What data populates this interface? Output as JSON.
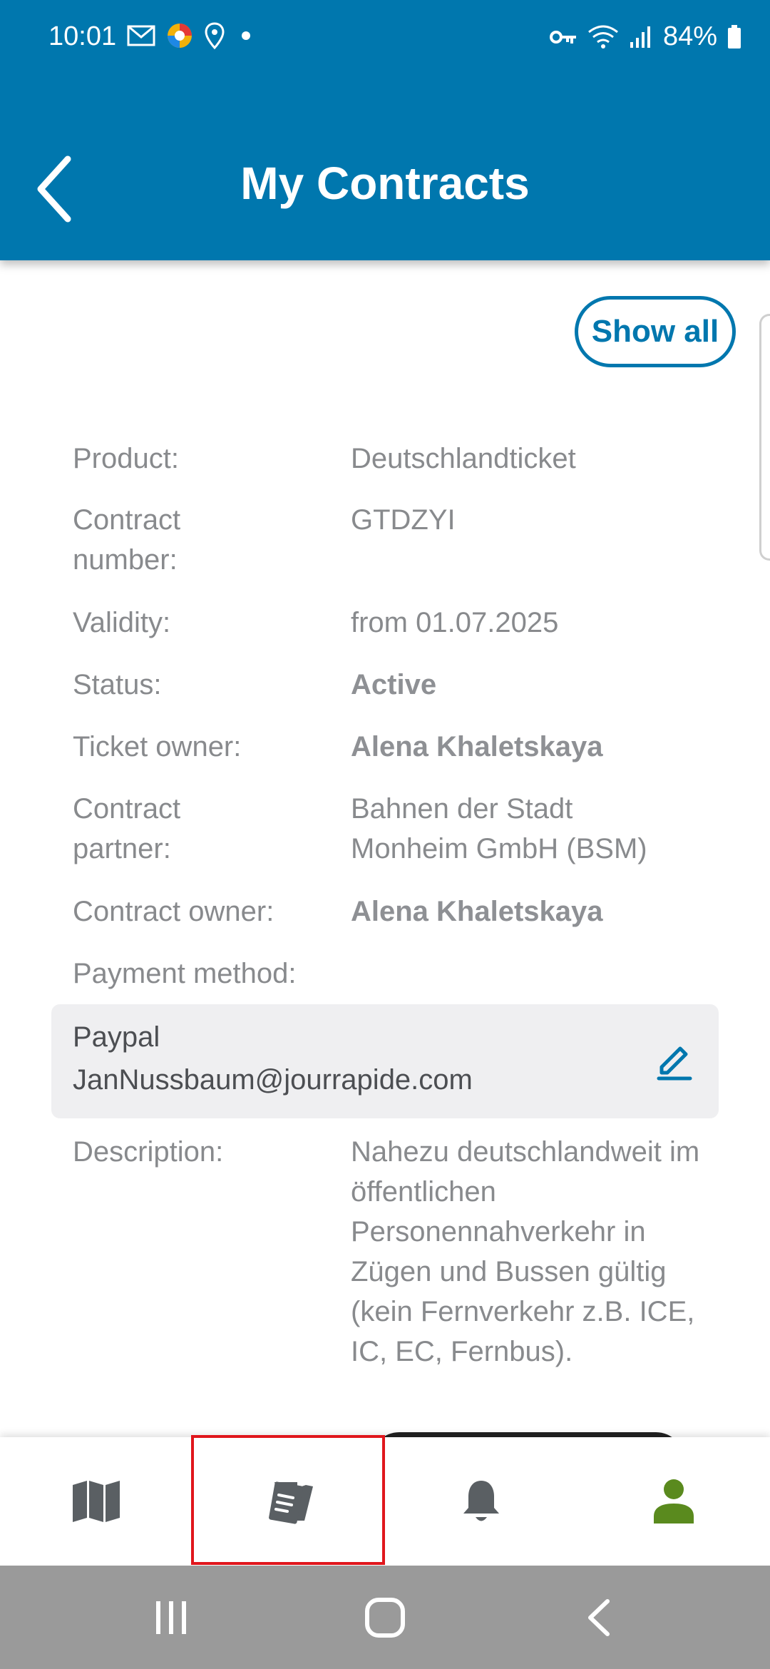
{
  "status_bar": {
    "time": "10:01",
    "battery": "84%"
  },
  "header": {
    "title": "My Contracts"
  },
  "actions": {
    "show_all": "Show all"
  },
  "contract": {
    "product_label": "Product:",
    "product_value": "Deutschlandticket",
    "number_label": "Contract number:",
    "number_value": "GTDZYI",
    "validity_label": "Validity:",
    "validity_value": "from 01.07.2025",
    "status_label": "Status:",
    "status_value": "Active",
    "ticket_owner_label": "Ticket owner:",
    "ticket_owner_value": "Alena Khaletskaya",
    "partner_label": "Contract partner:",
    "partner_value": "Bahnen der Stadt Monheim GmbH (BSM)",
    "contract_owner_label": "Contract owner:",
    "contract_owner_value": "Alena Khaletskaya",
    "payment_label": "Payment method:",
    "payment_name": "Paypal",
    "payment_email": "JanNussbaum@jourrapide.com",
    "description_label": "Description:",
    "description_value": "Nahezu deutschlandweit im öffentlichen Personennahverkehr in Zügen und Bussen gültig (kein Fernverkehr z.B. ICE, IC, EC, Fernbus)."
  },
  "bottom_nav": {
    "items": [
      "map-icon",
      "ticket-icon",
      "bell-icon",
      "person-icon"
    ],
    "selected": "ticket-icon"
  },
  "colors": {
    "brand": "#0077ae",
    "active_nav": "#5a8a1e",
    "highlight": "#e0161c"
  }
}
